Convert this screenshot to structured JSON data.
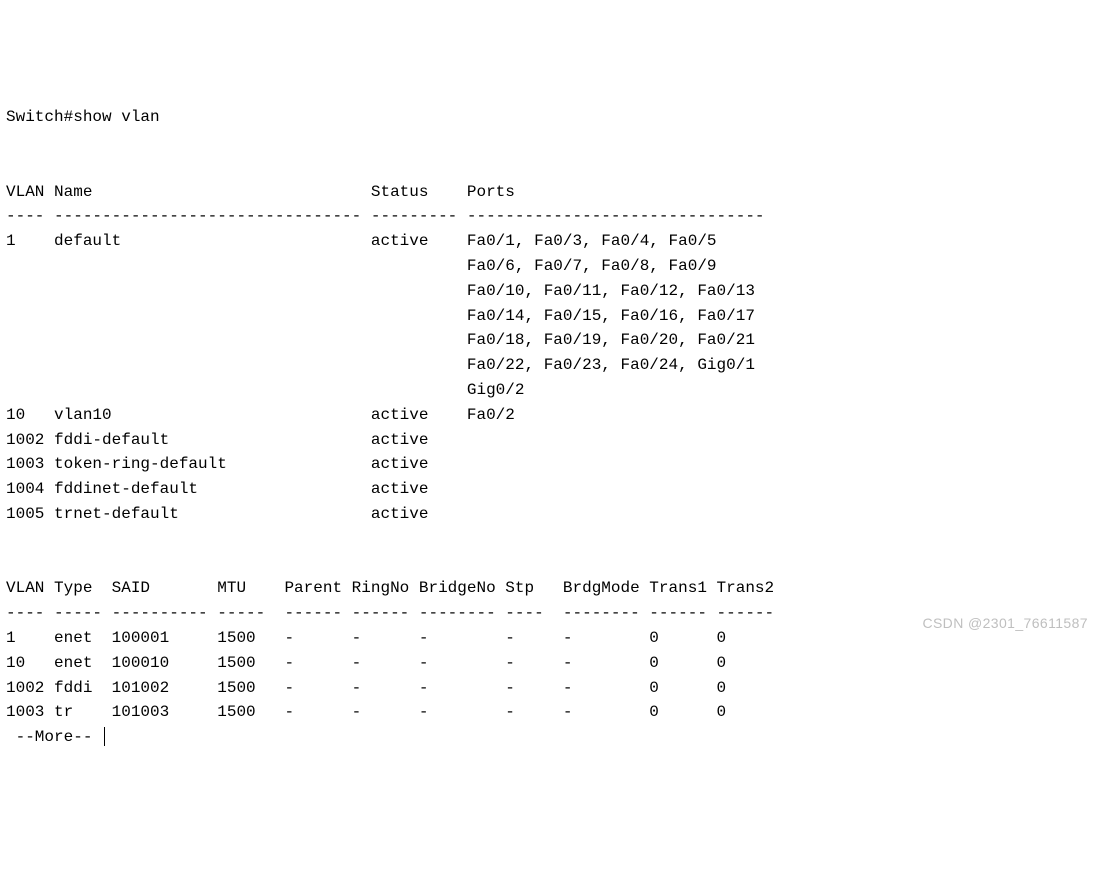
{
  "prompt": "Switch#",
  "command": "show vlan",
  "table1": {
    "headers": {
      "vlan": "VLAN",
      "name": "Name",
      "status": "Status",
      "ports": "Ports"
    },
    "rows": [
      {
        "vlan": "1",
        "name": "default",
        "status": "active",
        "ports_lines": [
          "Fa0/1, Fa0/3, Fa0/4, Fa0/5",
          "Fa0/6, Fa0/7, Fa0/8, Fa0/9",
          "Fa0/10, Fa0/11, Fa0/12, Fa0/13",
          "Fa0/14, Fa0/15, Fa0/16, Fa0/17",
          "Fa0/18, Fa0/19, Fa0/20, Fa0/21",
          "Fa0/22, Fa0/23, Fa0/24, Gig0/1",
          "Gig0/2"
        ]
      },
      {
        "vlan": "10",
        "name": "vlan10",
        "status": "active",
        "ports_lines": [
          "Fa0/2"
        ]
      },
      {
        "vlan": "1002",
        "name": "fddi-default",
        "status": "active",
        "ports_lines": []
      },
      {
        "vlan": "1003",
        "name": "token-ring-default",
        "status": "active",
        "ports_lines": []
      },
      {
        "vlan": "1004",
        "name": "fddinet-default",
        "status": "active",
        "ports_lines": []
      },
      {
        "vlan": "1005",
        "name": "trnet-default",
        "status": "active",
        "ports_lines": []
      }
    ]
  },
  "table2": {
    "headers": {
      "vlan": "VLAN",
      "type": "Type",
      "said": "SAID",
      "mtu": "MTU",
      "parent": "Parent",
      "ringno": "RingNo",
      "bridgeno": "BridgeNo",
      "stp": "Stp",
      "brdgmode": "BrdgMode",
      "trans1": "Trans1",
      "trans2": "Trans2"
    },
    "rows": [
      {
        "vlan": "1",
        "type": "enet",
        "said": "100001",
        "mtu": "1500",
        "parent": "-",
        "ringno": "-",
        "bridgeno": "-",
        "stp": "-",
        "brdgmode": "-",
        "trans1": "0",
        "trans2": "0"
      },
      {
        "vlan": "10",
        "type": "enet",
        "said": "100010",
        "mtu": "1500",
        "parent": "-",
        "ringno": "-",
        "bridgeno": "-",
        "stp": "-",
        "brdgmode": "-",
        "trans1": "0",
        "trans2": "0"
      },
      {
        "vlan": "1002",
        "type": "fddi",
        "said": "101002",
        "mtu": "1500",
        "parent": "-",
        "ringno": "-",
        "bridgeno": "-",
        "stp": "-",
        "brdgmode": "-",
        "trans1": "0",
        "trans2": "0"
      },
      {
        "vlan": "1003",
        "type": "tr",
        "said": "101003",
        "mtu": "1500",
        "parent": "-",
        "ringno": "-",
        "bridgeno": "-",
        "stp": "-",
        "brdgmode": "-",
        "trans1": "0",
        "trans2": "0"
      }
    ]
  },
  "pager": " --More-- ",
  "watermark": "CSDN @2301_76611587"
}
